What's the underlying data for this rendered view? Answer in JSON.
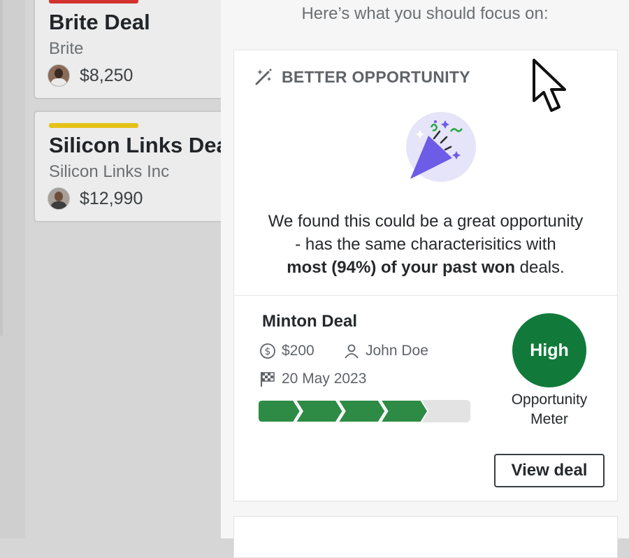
{
  "background_deals": [
    {
      "title": "Brite Deal",
      "organization": "Brite",
      "amount": "$8,250",
      "stage_color": "#d2312f"
    },
    {
      "title": "Silicon Links Deal",
      "organization": "Silicon Links Inc",
      "amount": "$12,990",
      "stage_color": "#e4c21a"
    }
  ],
  "panel": {
    "heading": "Here’s what you should focus on:",
    "card": {
      "tag": "BETTER OPPORTUNITY",
      "tag_icon": "magic-wand-icon",
      "illustration": "party-popper-icon",
      "message": {
        "line1": "We found this could be a great opportunity",
        "line2": "- has the same characterisitics with",
        "line3_bold": "most (94%) of your past won",
        "line3_tail": " deals."
      },
      "deal": {
        "name": "Minton Deal",
        "value": "$200",
        "owner": "John Doe",
        "close_date": "20 May 2023",
        "progress_stages_total": 5,
        "progress_stages_done": 4
      },
      "meter": {
        "level": "High",
        "label": "Opportunity Meter",
        "color": "#117a3b"
      },
      "view_button": "View deal"
    }
  },
  "colors": {
    "accent_green": "#117a3b",
    "progress_green": "#2e8b45",
    "popper_purple": "#6d5ce6"
  }
}
